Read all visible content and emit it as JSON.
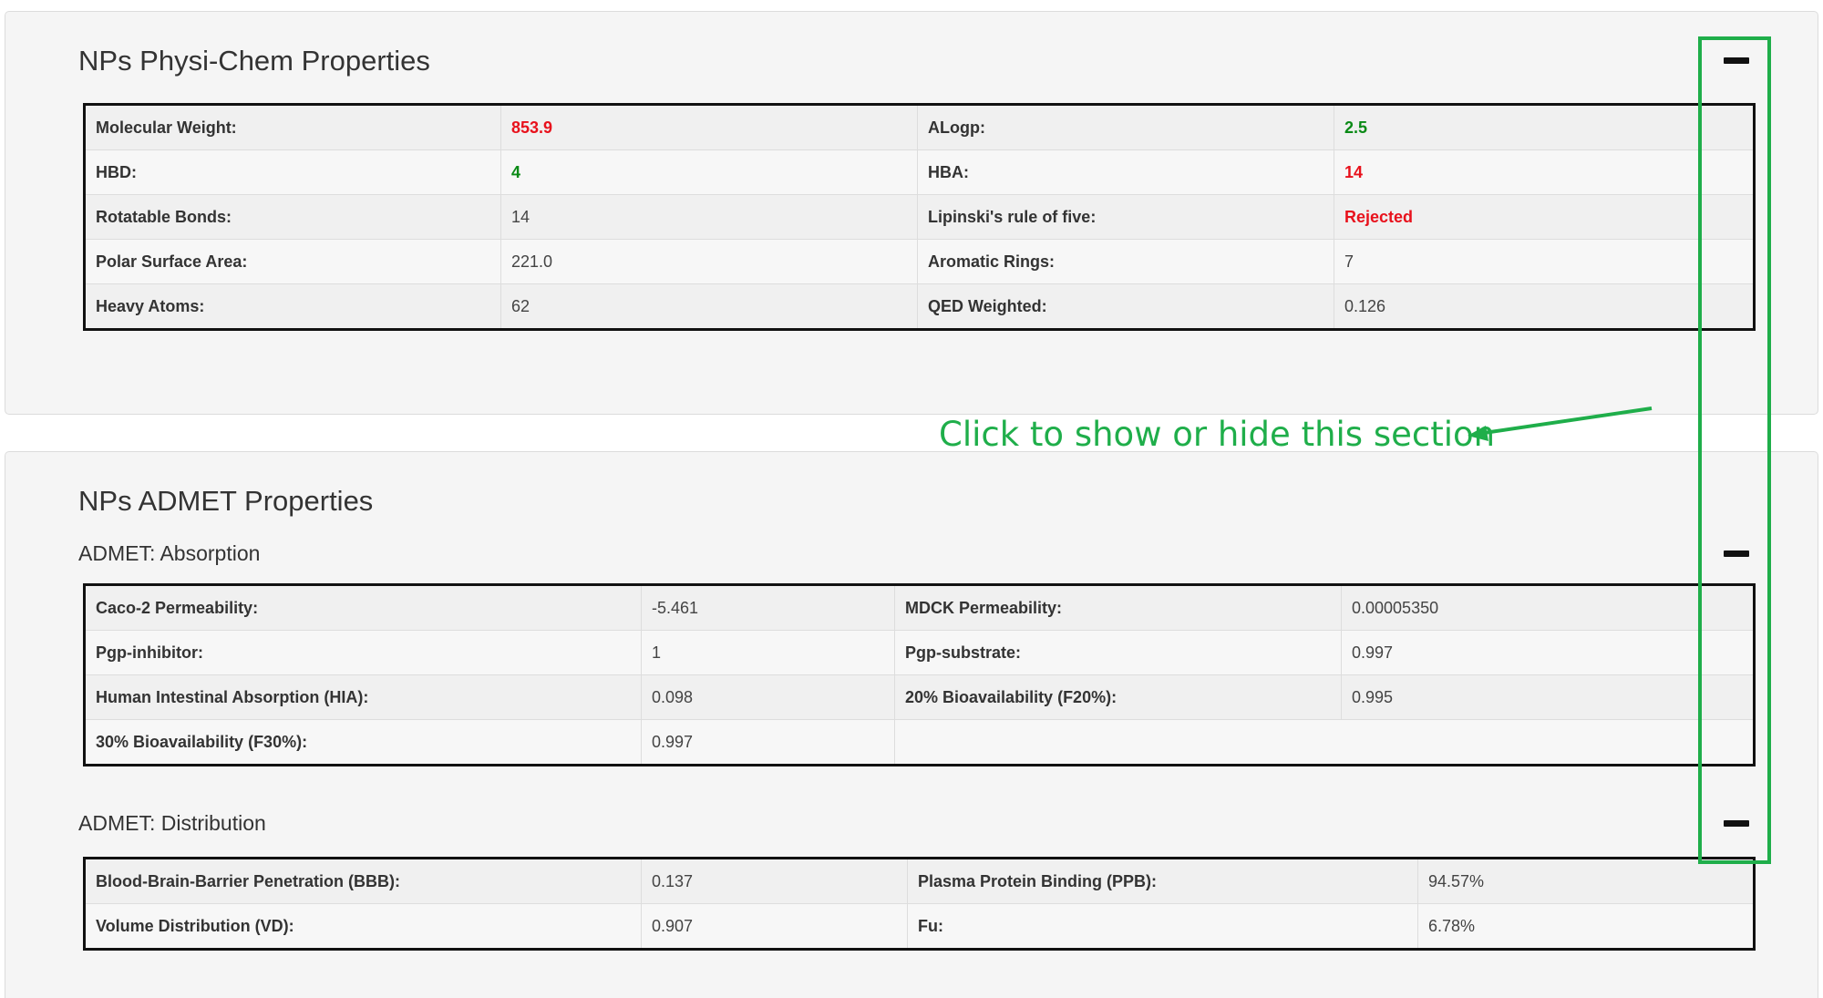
{
  "panel1": {
    "title": "NPs Physi-Chem Properties",
    "rows": [
      {
        "k1": "Molecular Weight:",
        "v1": "853.9",
        "k2": "ALogp:",
        "v2": "2.5"
      },
      {
        "k1": "HBD:",
        "v1": "4",
        "k2": "HBA:",
        "v2": "14"
      },
      {
        "k1": "Rotatable Bonds:",
        "v1": "14",
        "k2": "Lipinski's rule of five:",
        "v2": "Rejected"
      },
      {
        "k1": "Polar Surface Area:",
        "v1": "221.0",
        "k2": "Aromatic Rings:",
        "v2": "7"
      },
      {
        "k1": "Heavy Atoms:",
        "v1": "62",
        "k2": "QED Weighted:",
        "v2": "0.126"
      }
    ]
  },
  "panel2": {
    "title": "NPs ADMET Properties",
    "absorption": {
      "title": "ADMET: Absorption",
      "rows": [
        {
          "k1": "Caco-2 Permeability:",
          "v1": "-5.461",
          "k2": "MDCK Permeability:",
          "v2": "0.00005350"
        },
        {
          "k1": "Pgp-inhibitor:",
          "v1": "1",
          "k2": "Pgp-substrate:",
          "v2": "0.997"
        },
        {
          "k1": "Human Intestinal Absorption (HIA):",
          "v1": "0.098",
          "k2": "20% Bioavailability (F20%):",
          "v2": "0.995"
        },
        {
          "k1": "30% Bioavailability (F30%):",
          "v1": "0.997",
          "k2": "",
          "v2": ""
        }
      ]
    },
    "distribution": {
      "title": "ADMET: Distribution",
      "rows": [
        {
          "k1": "Blood-Brain-Barrier Penetration (BBB):",
          "v1": "0.137",
          "k2": "Plasma Protein Binding (PPB):",
          "v2": "94.57%"
        },
        {
          "k1": "Volume Distribution (VD):",
          "v1": "0.907",
          "k2": "Fu:",
          "v2": "6.78%"
        }
      ]
    }
  },
  "annotation": {
    "text": "Click to show or hide this section",
    "color": "#1fae4a"
  },
  "colors": {
    "value_bad": "#e8111c",
    "value_good": "#0a8a16"
  },
  "icons": {
    "toggle": "minus-icon"
  }
}
